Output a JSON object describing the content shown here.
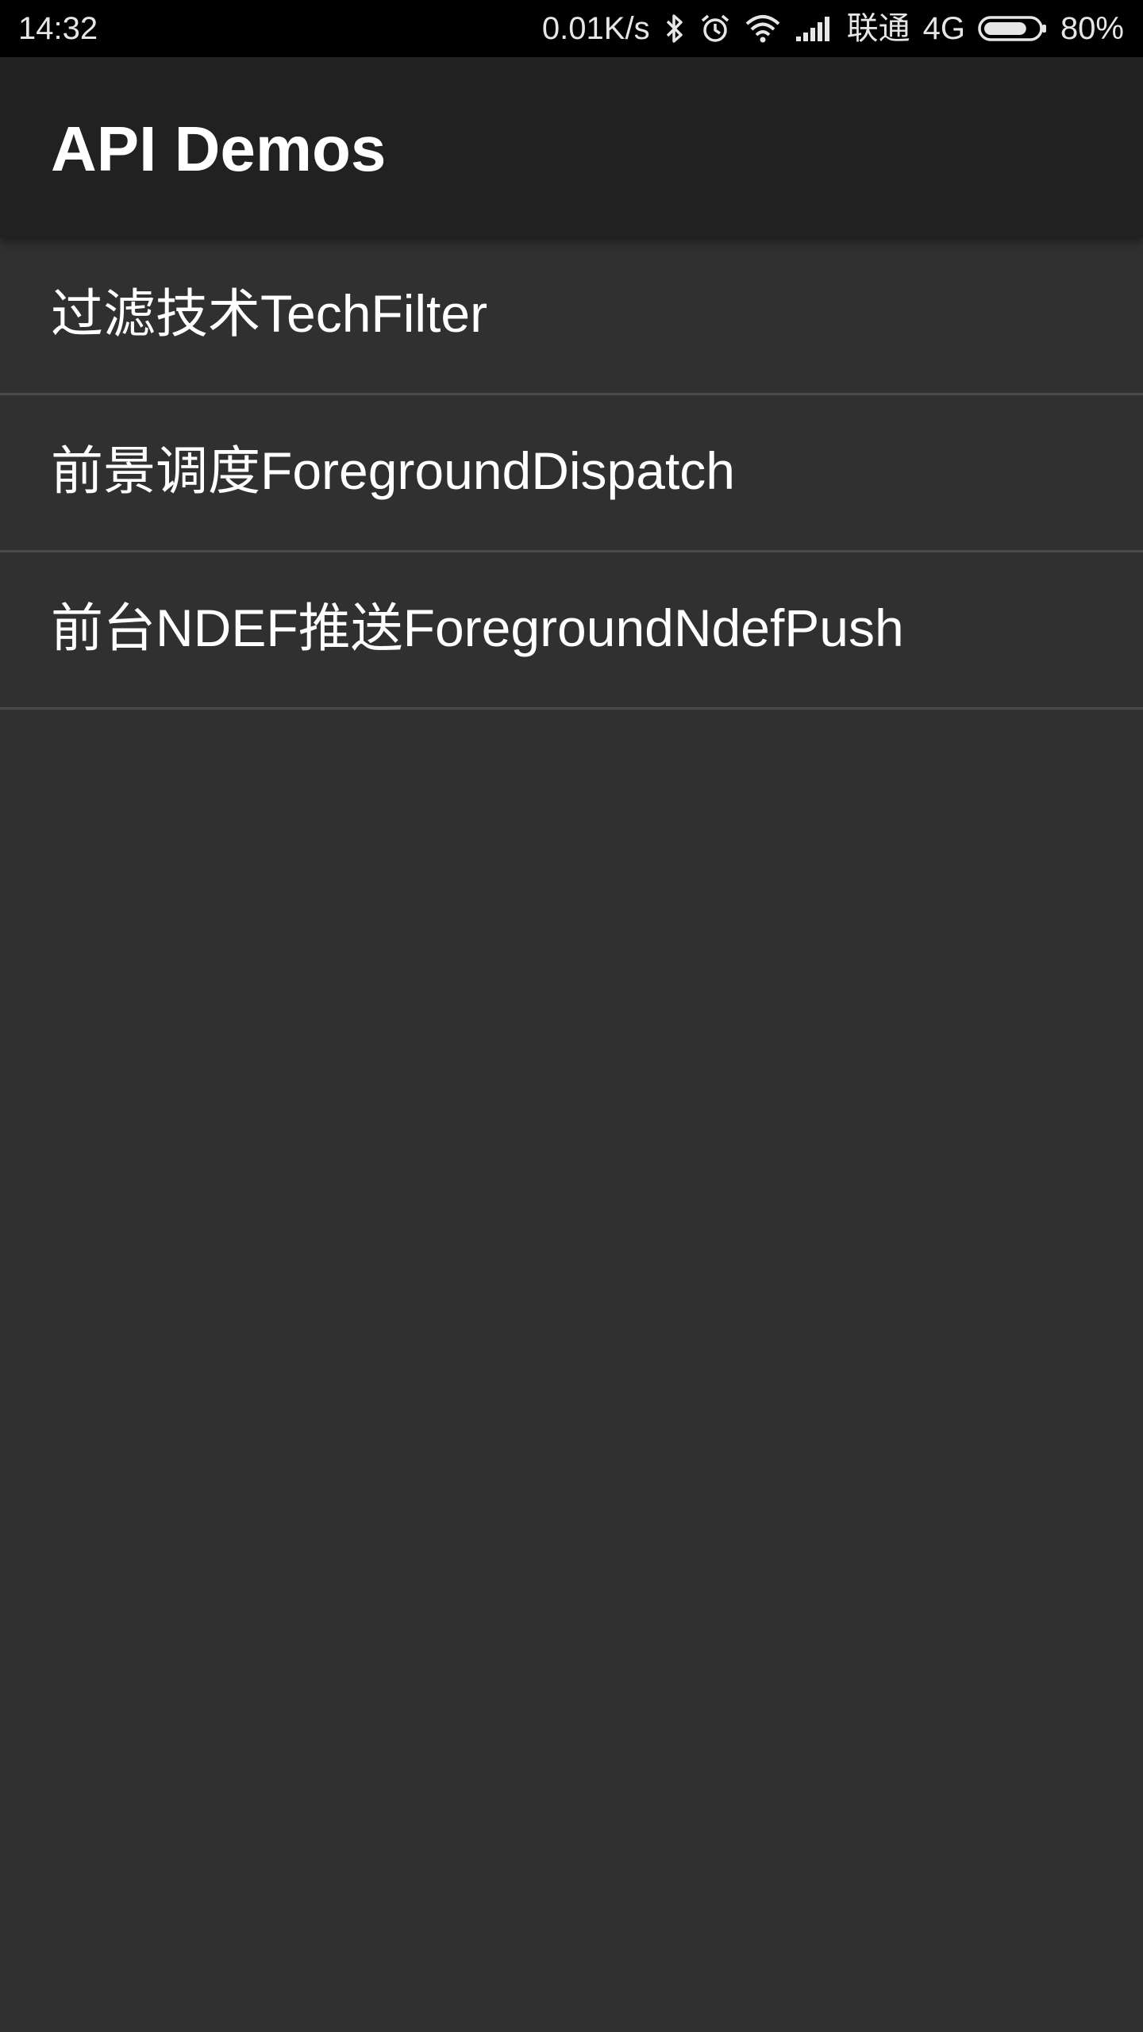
{
  "status_bar": {
    "time": "14:32",
    "network_speed": "0.01K/s",
    "carrier": "联通",
    "network_type": "4G",
    "battery": "80%",
    "battery_level": 0.8,
    "icons": [
      "bluetooth-icon",
      "alarm-icon",
      "wifi-icon",
      "signal-icon",
      "battery-icon"
    ]
  },
  "app_bar": {
    "title": "API Demos"
  },
  "list": {
    "items": [
      {
        "label": "过滤技术TechFilter"
      },
      {
        "label": "前景调度ForegroundDispatch"
      },
      {
        "label": "前台NDEF推送ForegroundNdefPush"
      }
    ]
  },
  "colors": {
    "status_bar_bg": "#000000",
    "app_bar_bg": "#212121",
    "content_bg": "#303030",
    "divider": "#4a4a4a",
    "text": "#ffffff"
  }
}
